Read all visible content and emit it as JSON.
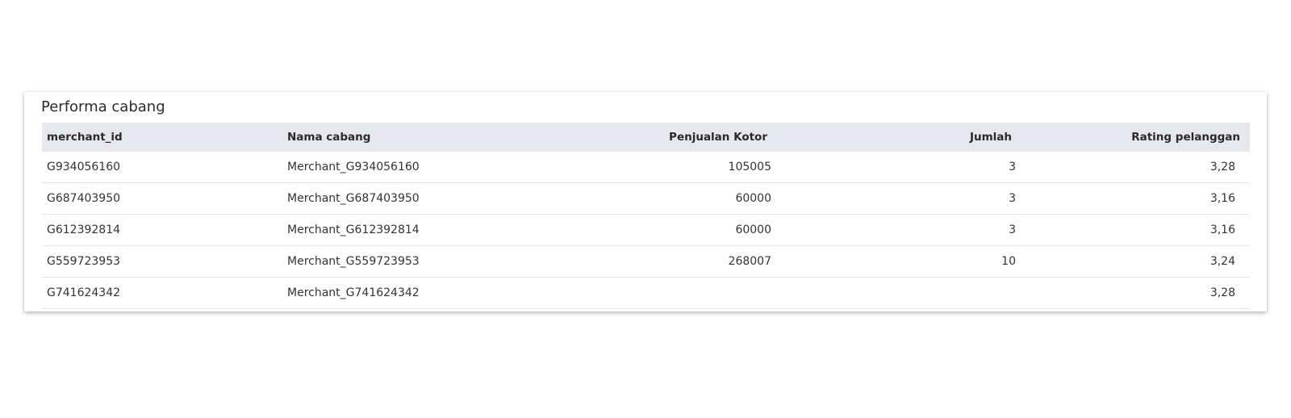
{
  "widget": {
    "title": "Performa cabang"
  },
  "table": {
    "columns": [
      "merchant_id",
      "Nama cabang",
      "Penjualan Kotor",
      "Jumlah",
      "Rating pelanggan"
    ],
    "rows": [
      [
        "G934056160",
        "Merchant_G934056160",
        "105005",
        "3",
        "3,28"
      ],
      [
        "G687403950",
        "Merchant_G687403950",
        "60000",
        "3",
        "3,16"
      ],
      [
        "G612392814",
        "Merchant_G612392814",
        "60000",
        "3",
        "3,16"
      ],
      [
        "G559723953",
        "Merchant_G559723953",
        "268007",
        "10",
        "3,24"
      ],
      [
        "G741624342",
        "Merchant_G741624342",
        "",
        "",
        "3,28"
      ]
    ]
  }
}
